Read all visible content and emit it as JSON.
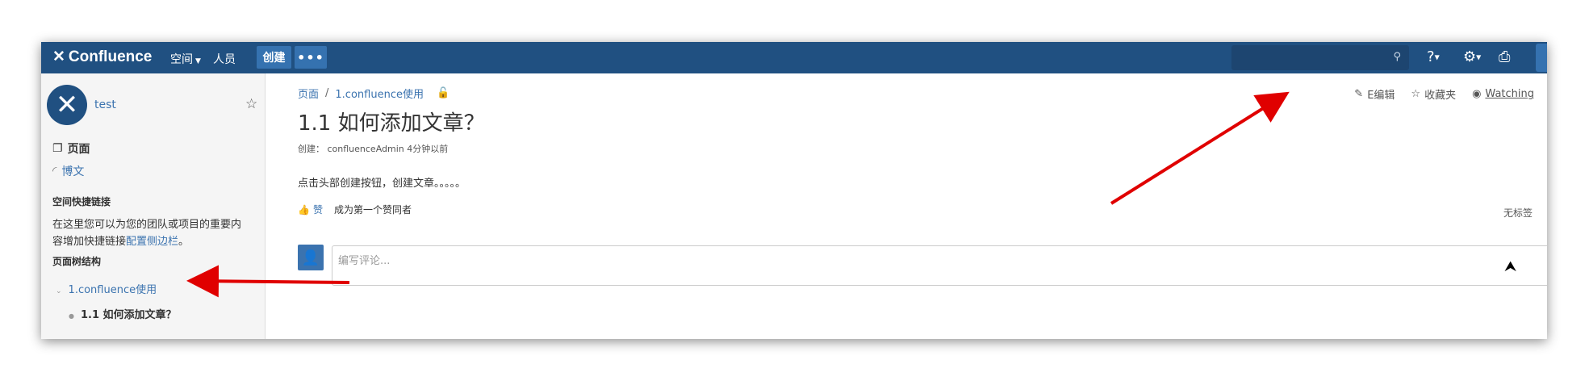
{
  "header": {
    "logo_text": "Confluence",
    "nav_spaces": "空间",
    "nav_people": "人员",
    "create_label": "创建",
    "more_label": "•••",
    "icons": [
      "search-icon",
      "help-icon",
      "gear-icon",
      "notifications-icon",
      "user-avatar"
    ]
  },
  "sidebar": {
    "space_name": "test",
    "pages_label": "页面",
    "blog_label": "博文",
    "shortcuts_heading": "空间快捷链接",
    "shortcuts_text": "在这里您可以为您的团队或项目的重要内容增加快捷链接",
    "shortcuts_link": "配置侧边栏",
    "shortcuts_end": "。",
    "tree_heading": "页面树结构",
    "tree_parent": "1.confluence使用",
    "tree_child": "1.1 如何添加文章？"
  },
  "page": {
    "breadcrumb_root": "页面",
    "breadcrumb_sep": "/",
    "breadcrumb_parent": "1.confluence使用",
    "title": "1.1 如何添加文章？",
    "meta": "创建：   confluenceAdmin 4分钟以前",
    "body": "点击头部创建按钮，创建文章。。。。。",
    "like_label": "赞",
    "first_like": "成为第一个赞同者",
    "labels_text": "无标签",
    "comment_placeholder": "编写评论..."
  },
  "actions": {
    "edit": "E编辑",
    "save": "收藏夹",
    "watching": "Watching"
  },
  "colors": {
    "header_bg": "#205081",
    "link": "#3b73af",
    "annotation_arrow": "#e00000"
  }
}
